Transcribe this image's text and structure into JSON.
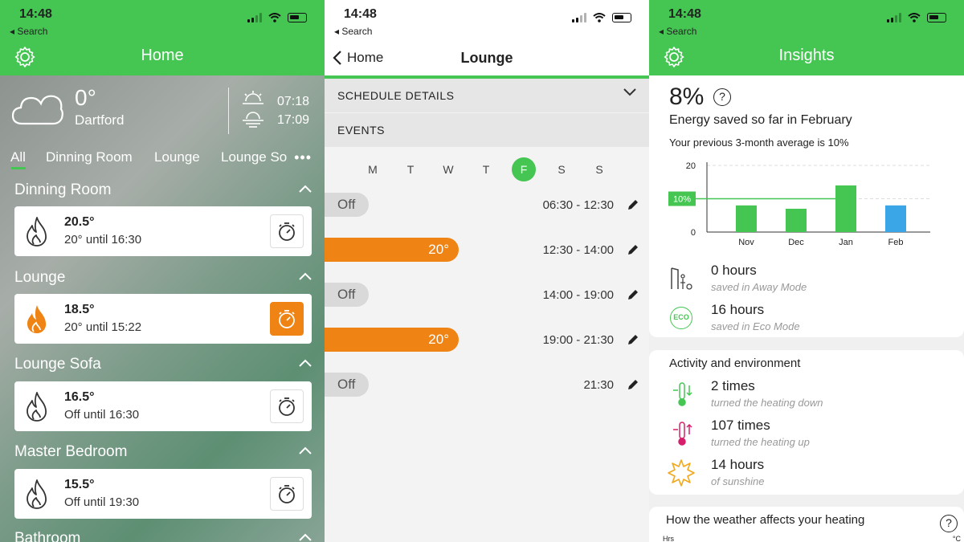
{
  "status": {
    "time": "14:48",
    "back_label": "◂ Search"
  },
  "home": {
    "title": "Home",
    "weather": {
      "temp": "0°",
      "location": "Dartford",
      "sunrise": "07:18",
      "sunset": "17:09"
    },
    "tabs": [
      "All",
      "Dinning Room",
      "Lounge",
      "Lounge So"
    ],
    "more": "•••",
    "rooms": [
      {
        "name": "Dinning Room",
        "temp": "20.5°",
        "status": "20° until 16:30",
        "heating": false
      },
      {
        "name": "Lounge",
        "temp": "18.5°",
        "status": "20° until 15:22",
        "heating": true
      },
      {
        "name": "Lounge Sofa",
        "temp": "16.5°",
        "status": "Off until 16:30",
        "heating": false
      },
      {
        "name": "Master Bedroom",
        "temp": "15.5°",
        "status": "Off until 19:30",
        "heating": false
      },
      {
        "name": "Bathroom"
      }
    ]
  },
  "schedule": {
    "back_label": "Home",
    "title": "Lounge",
    "section_details": "SCHEDULE DETAILS",
    "section_events": "EVENTS",
    "days": [
      "M",
      "T",
      "W",
      "T",
      "F",
      "S",
      "S"
    ],
    "selected_day_index": 4,
    "events": [
      {
        "label": "Off",
        "time": "06:30 - 12:30",
        "on": false
      },
      {
        "label": "20°",
        "time": "12:30 - 14:00",
        "on": true
      },
      {
        "label": "Off",
        "time": "14:00 - 19:00",
        "on": false
      },
      {
        "label": "20°",
        "time": "19:00 - 21:30",
        "on": true
      },
      {
        "label": "Off",
        "time": "21:30",
        "on": false
      }
    ]
  },
  "insights": {
    "title": "Insights",
    "percent": "8%",
    "help": "?",
    "saved_text": "Energy saved so far in February",
    "previous_text": "Your previous 3-month average is 10%",
    "stats": [
      {
        "value": "0 hours",
        "label": "saved in Away Mode",
        "icon": "away-mode-icon"
      },
      {
        "value": "16 hours",
        "label": "saved in Eco Mode",
        "icon": "eco-icon"
      }
    ],
    "activity_title": "Activity and environment",
    "activity": [
      {
        "value": "2 times",
        "label": "turned the heating down",
        "icon": "thermometer-down-icon"
      },
      {
        "value": "107 times",
        "label": "turned the heating up",
        "icon": "thermometer-up-icon"
      },
      {
        "value": "14 hours",
        "label": "of sunshine",
        "icon": "sun-icon"
      }
    ],
    "eco_badge": "ECO",
    "weather_title": "How the weather affects your heating",
    "hrs_label": "Hrs",
    "degc_label": "°C"
  },
  "chart_data": {
    "type": "bar",
    "categories": [
      "Nov",
      "Dec",
      "Jan",
      "Feb"
    ],
    "values": [
      8,
      7,
      14,
      8
    ],
    "yticks": [
      0,
      10,
      20
    ],
    "ylim": [
      0,
      20
    ],
    "reference_line": {
      "value": 10,
      "label": "10%"
    },
    "colors": [
      "#45c653",
      "#45c653",
      "#45c653",
      "#3aa6e8"
    ]
  },
  "colors": {
    "brand_green": "#45c653",
    "heating_orange": "#ef8414",
    "feb_blue": "#3aa6e8"
  }
}
